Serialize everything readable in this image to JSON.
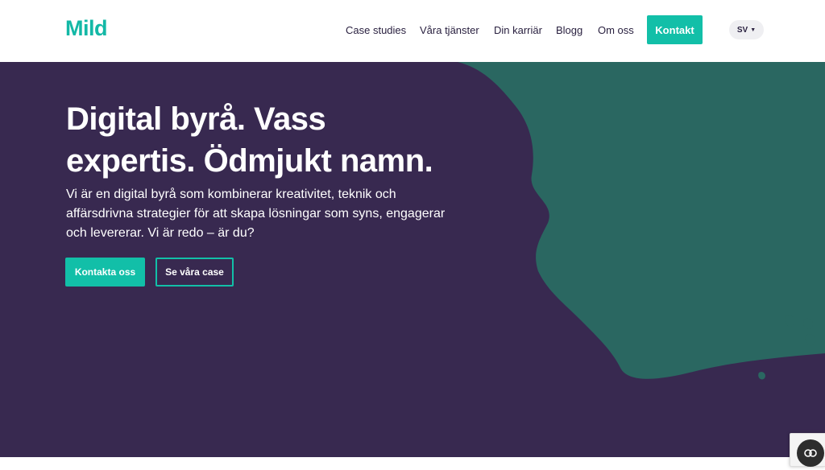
{
  "header": {
    "logo": "Mild",
    "nav": [
      {
        "label": "Case studies"
      },
      {
        "label": "Våra tjänster"
      },
      {
        "label": "Din karriär"
      },
      {
        "label": "Blogg"
      },
      {
        "label": "Om oss"
      }
    ],
    "cta": "Kontakt",
    "language": "SV"
  },
  "hero": {
    "title_line1": "Digital byrå. Vass",
    "title_line2": "expertis. Ödmjukt namn.",
    "subtitle_line1": "Vi är en digital byrå som kombinerar kreativitet, teknik och",
    "subtitle_line2": "affärsdrivna strategier för att skapa lösningar som syns, engagerar",
    "subtitle_line3": "och levererar. Vi är redo – är du?",
    "primary_button": "Kontakta oss",
    "secondary_button": "Se våra case"
  },
  "colors": {
    "brand_teal": "#12bfa8",
    "hero_purple": "#382950",
    "hero_green": "#2a6761"
  },
  "icons": {
    "language_caret": "caret-down-icon",
    "captcha_badge": "recaptcha-icon"
  }
}
